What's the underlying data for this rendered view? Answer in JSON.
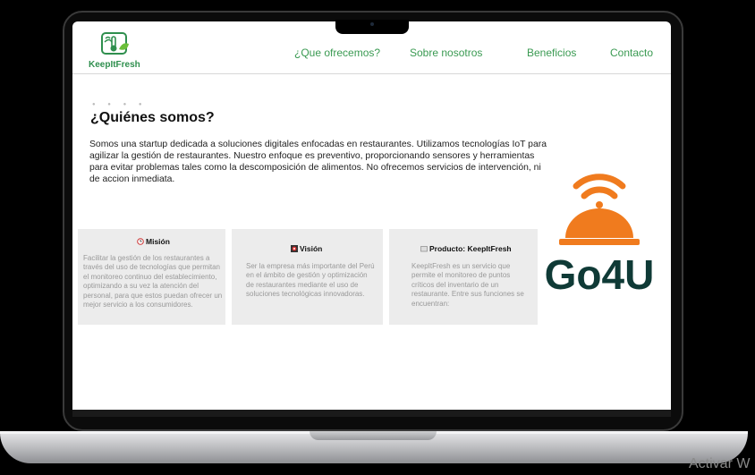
{
  "site": {
    "logo_text": "KeepItFresh",
    "nav": [
      "¿Que ofrecemos?",
      "Sobre nosotros",
      "Beneficios",
      "Contacto"
    ]
  },
  "about": {
    "title": "¿Quiénes somos?",
    "body": "Somos una startup dedicada a soluciones digitales enfocadas en restaurantes. Utilizamos tecnologías IoT para agilizar la gestión de restaurantes. Nuestro enfoque es preventivo, proporcionando sensores y herramientas para evitar problemas tales como la descomposición de alimentos. No ofrecemos servicios de intervención, ni de accion inmediata."
  },
  "cards": [
    {
      "title": "Misión",
      "icon": "clock-icon",
      "body": "Facilitar la gestión de los restaurantes a través del uso de tecnologías que permitan el monitoreo continuo del establecimiento, optimizando a su vez la atención del personal, para que estos puedan ofrecer un mejor servicio a los consumidores."
    },
    {
      "title": "Visión",
      "icon": "target-icon",
      "body": "Ser la empresa más importante del Perú en el ámbito de gestión y optimización de restaurantes mediante el uso de soluciones tecnológicas innovadoras."
    },
    {
      "title": "Producto: KeepItFresh",
      "icon": "box-icon",
      "body": "KeepItFresh es un servicio que permite el monitoreo de puntos críticos del inventario de un restaurante. Entre sus funciones se encuentran:"
    }
  ],
  "brand": {
    "name": "Go4U",
    "bell_color": "#f07b1e",
    "text_color": "#0f3a36"
  },
  "os_watermark": "Activar W",
  "colors": {
    "accent_green": "#3a9a52",
    "card_bg": "#ececec"
  }
}
